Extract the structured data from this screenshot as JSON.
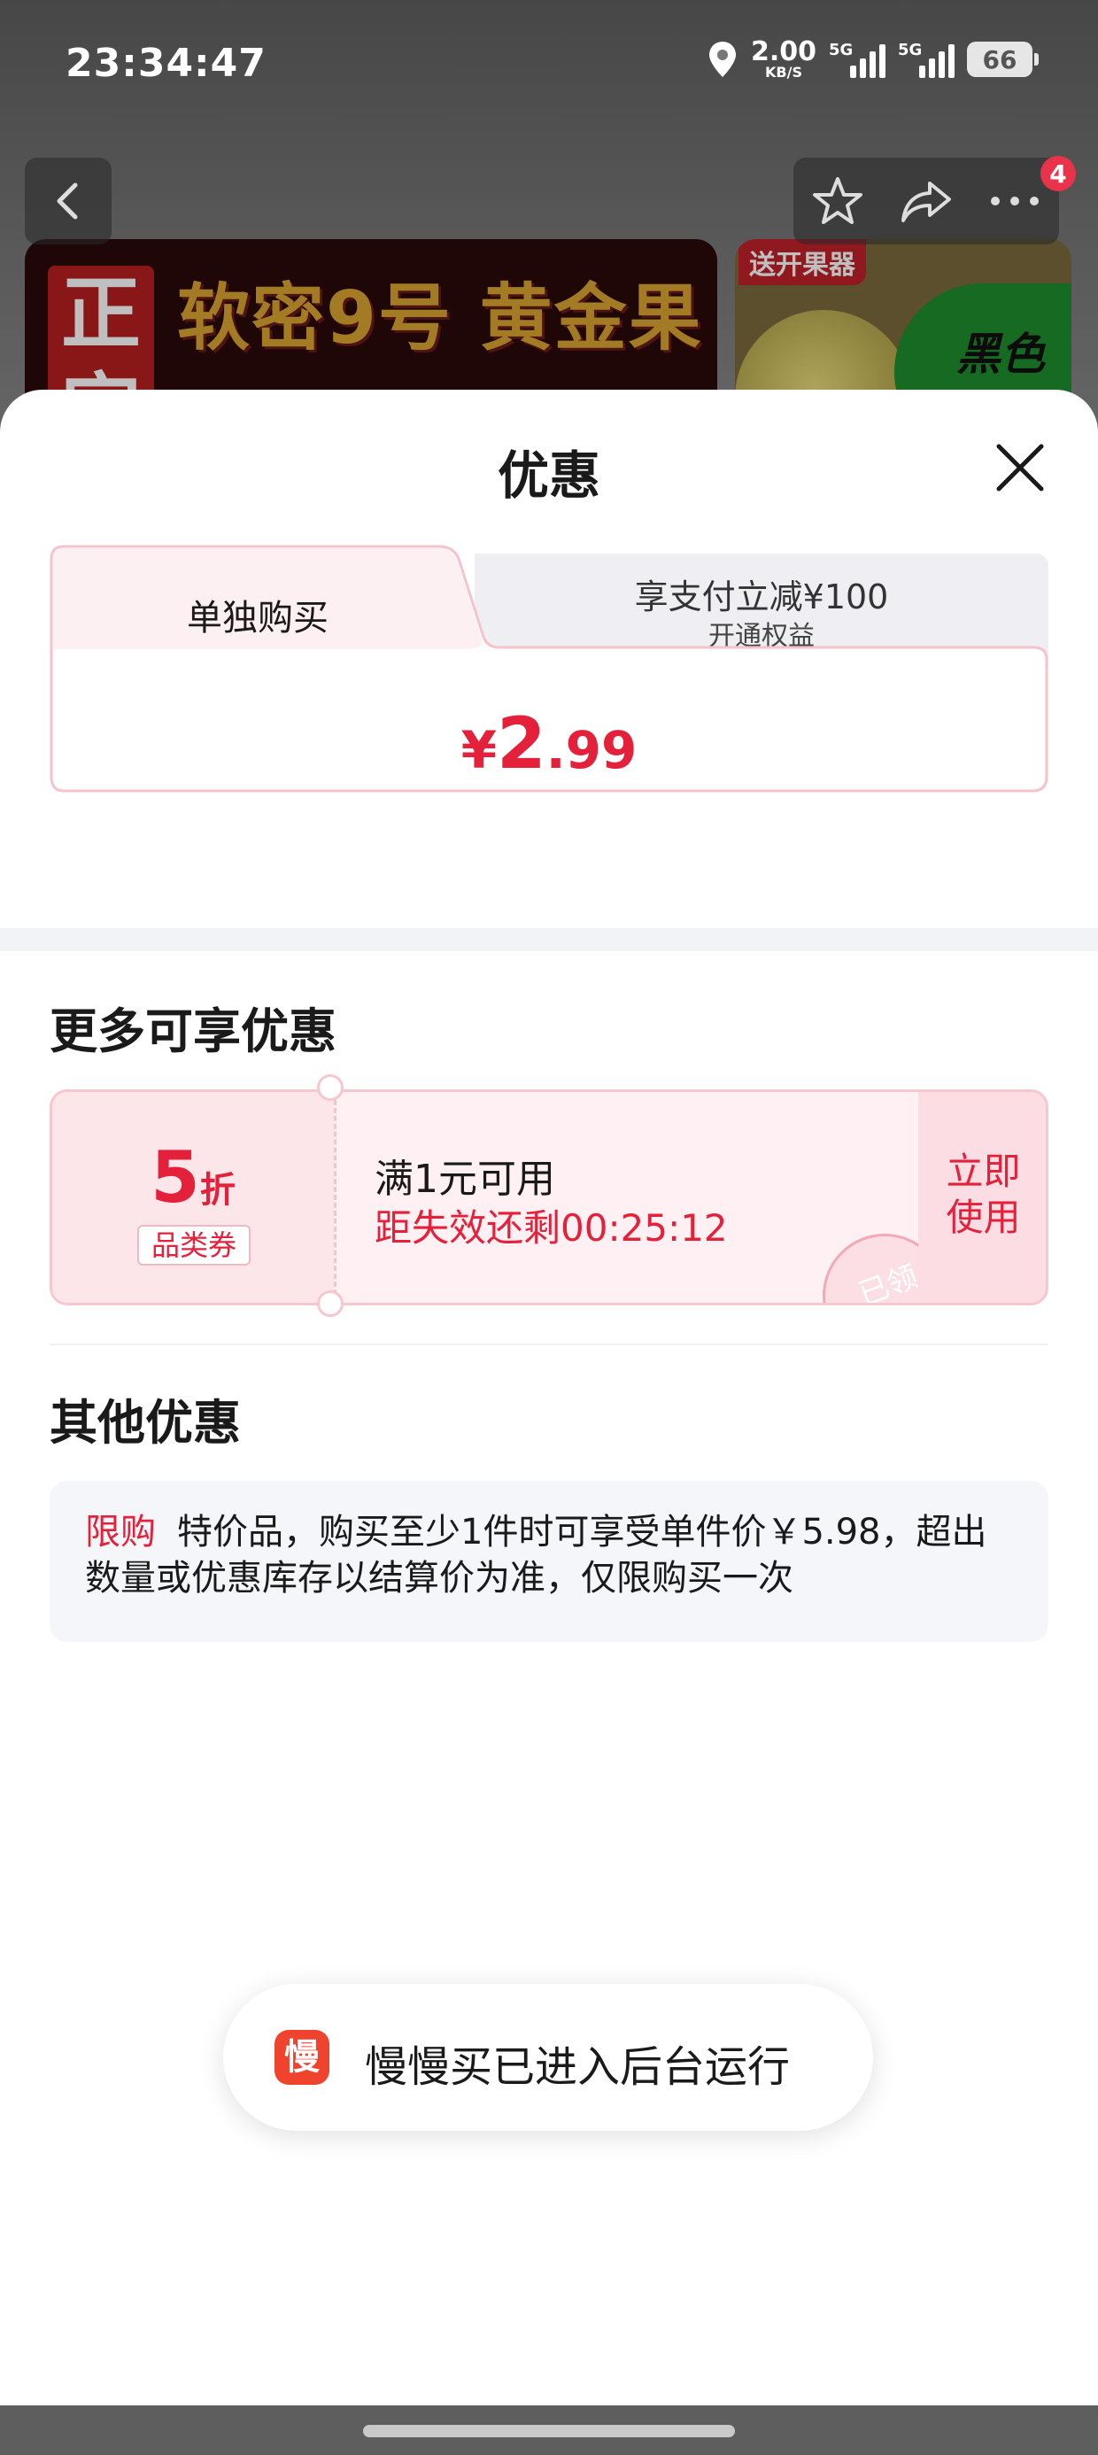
{
  "status_bar": {
    "time": "23:34:47",
    "net_speed_value": "2.00",
    "net_speed_unit": "KB/S",
    "signal1_label": "5G",
    "signal2_label": "5G",
    "battery": "66",
    "icons": [
      "location-icon",
      "signal-icon",
      "battery-icon"
    ]
  },
  "product_nav": {
    "cart_badge": "4",
    "icons": [
      "back-icon",
      "star-icon",
      "share-icon",
      "more-icon"
    ]
  },
  "product_banner": {
    "stamp_text": "正宗",
    "headline": "软密9号 黄金果",
    "side_badge": "送开果器",
    "side_text": "黑色"
  },
  "sheet": {
    "title": "优惠",
    "tabs": {
      "single_buy": "单独购买",
      "pay_discount": "享支付立减¥100",
      "pay_discount_sub": "开通权益"
    },
    "price": {
      "currency": "¥",
      "integer": "2",
      "decimal": ".99"
    },
    "more_title": "更多可享优惠",
    "coupon": {
      "discount_value": "5",
      "discount_unit": "折",
      "category_tag": "品类券",
      "condition": "满1元可用",
      "countdown": "距失效还剩00:25:12",
      "claimed_stamp": "已领",
      "use_button": "立即使用"
    },
    "other_title": "其他优惠",
    "other": {
      "tag": "限购",
      "text": "特价品，购买至少1件时可享受单件价￥5.98，超出数量或优惠库存以结算价为准，仅限购买一次"
    }
  },
  "toast": {
    "icon_text": "慢",
    "message": "慢慢买已进入后台运行"
  },
  "colors": {
    "accent_red": "#e5203a",
    "coupon_bg": "#fff1f3",
    "toast_icon": "#f0432d"
  }
}
